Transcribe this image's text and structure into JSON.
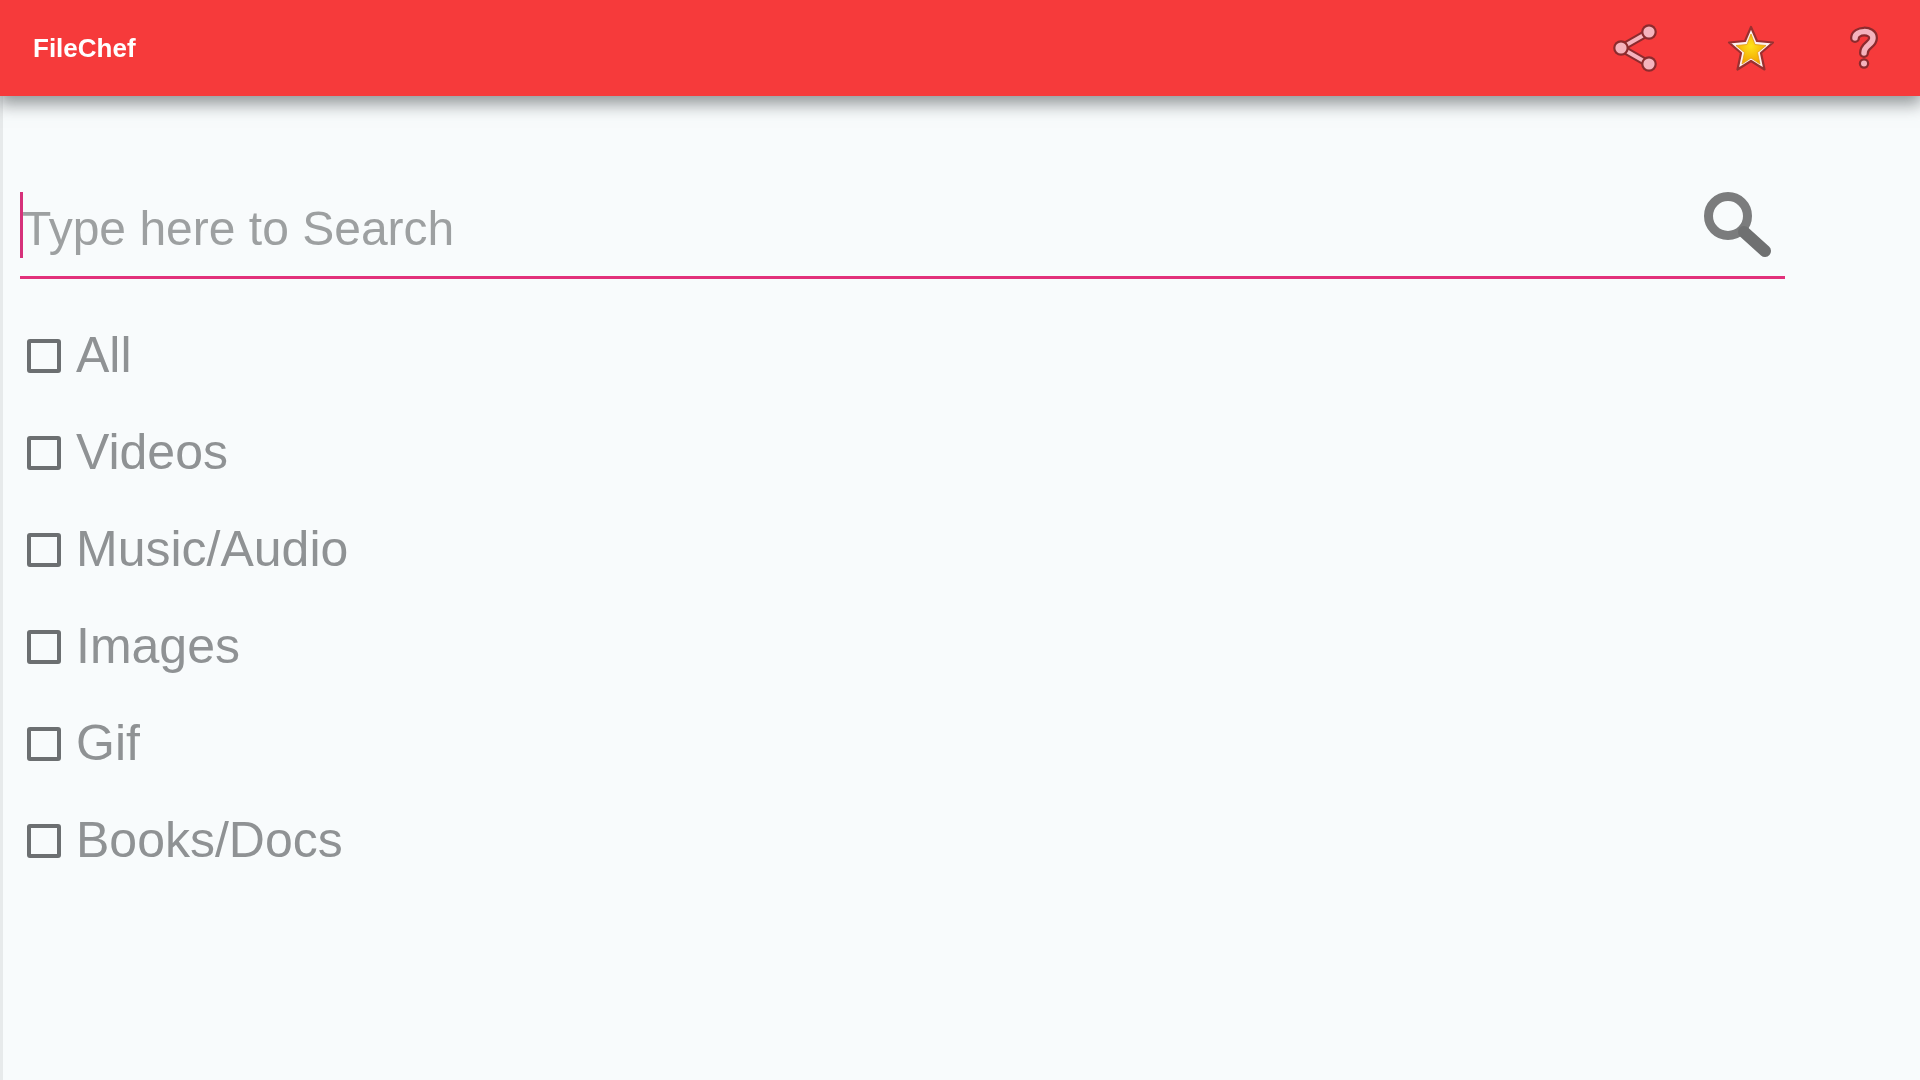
{
  "app_bar": {
    "title": "FileChef"
  },
  "search": {
    "placeholder": "Type here to Search",
    "focused": true
  },
  "filters": [
    {
      "label": "All",
      "checked": false
    },
    {
      "label": "Videos",
      "checked": false
    },
    {
      "label": "Music/Audio",
      "checked": false
    },
    {
      "label": "Images",
      "checked": false
    },
    {
      "label": "Gif",
      "checked": false
    },
    {
      "label": "Books/Docs",
      "checked": false
    }
  ]
}
